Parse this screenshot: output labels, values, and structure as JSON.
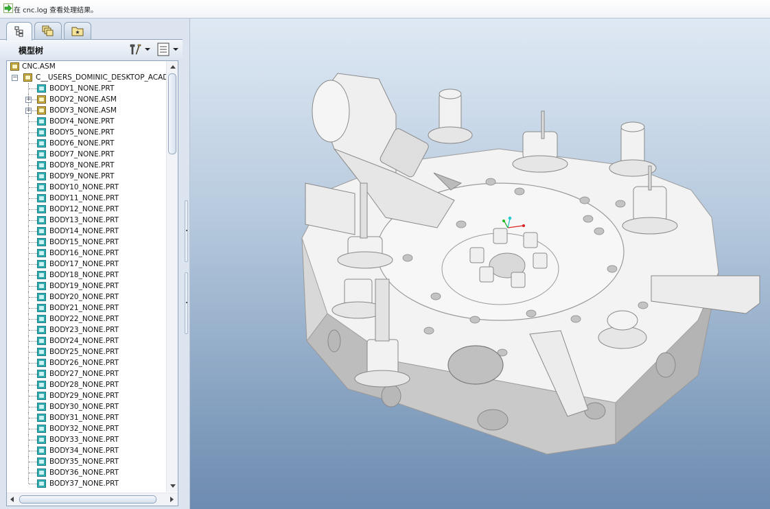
{
  "message": {
    "text": "在 cnc.log 查看处理结果。",
    "icon": "green-arrow-icon"
  },
  "panel": {
    "tabs": [
      {
        "name": "model-tree-tab",
        "icon": "tree-icon",
        "active": true
      },
      {
        "name": "layers-tab",
        "icon": "layers-icon",
        "active": false
      },
      {
        "name": "folder-browser-tab",
        "icon": "folder-icon",
        "active": false
      }
    ],
    "title": "模型树",
    "settings_icon": "tools-icon",
    "show_icon": "list-icon"
  },
  "tree": {
    "root": "CNC.ASM",
    "sub_assembly": "C__USERS_DOMINIC_DESKTOP_ACAD",
    "items": [
      {
        "label": "BODY1_NONE.PRT",
        "type": "part",
        "expandable": false
      },
      {
        "label": "BODY2_NONE.ASM",
        "type": "assembly",
        "expandable": true
      },
      {
        "label": "BODY3_NONE.ASM",
        "type": "assembly",
        "expandable": true
      },
      {
        "label": "BODY4_NONE.PRT",
        "type": "part",
        "expandable": false
      },
      {
        "label": "BODY5_NONE.PRT",
        "type": "part",
        "expandable": false
      },
      {
        "label": "BODY6_NONE.PRT",
        "type": "part",
        "expandable": false
      },
      {
        "label": "BODY7_NONE.PRT",
        "type": "part",
        "expandable": false
      },
      {
        "label": "BODY8_NONE.PRT",
        "type": "part",
        "expandable": false
      },
      {
        "label": "BODY9_NONE.PRT",
        "type": "part",
        "expandable": false
      },
      {
        "label": "BODY10_NONE.PRT",
        "type": "part",
        "expandable": false
      },
      {
        "label": "BODY11_NONE.PRT",
        "type": "part",
        "expandable": false
      },
      {
        "label": "BODY12_NONE.PRT",
        "type": "part",
        "expandable": false
      },
      {
        "label": "BODY13_NONE.PRT",
        "type": "part",
        "expandable": false
      },
      {
        "label": "BODY14_NONE.PRT",
        "type": "part",
        "expandable": false
      },
      {
        "label": "BODY15_NONE.PRT",
        "type": "part",
        "expandable": false
      },
      {
        "label": "BODY16_NONE.PRT",
        "type": "part",
        "expandable": false
      },
      {
        "label": "BODY17_NONE.PRT",
        "type": "part",
        "expandable": false
      },
      {
        "label": "BODY18_NONE.PRT",
        "type": "part",
        "expandable": false
      },
      {
        "label": "BODY19_NONE.PRT",
        "type": "part",
        "expandable": false
      },
      {
        "label": "BODY20_NONE.PRT",
        "type": "part",
        "expandable": false
      },
      {
        "label": "BODY21_NONE.PRT",
        "type": "part",
        "expandable": false
      },
      {
        "label": "BODY22_NONE.PRT",
        "type": "part",
        "expandable": false
      },
      {
        "label": "BODY23_NONE.PRT",
        "type": "part",
        "expandable": false
      },
      {
        "label": "BODY24_NONE.PRT",
        "type": "part",
        "expandable": false
      },
      {
        "label": "BODY25_NONE.PRT",
        "type": "part",
        "expandable": false
      },
      {
        "label": "BODY26_NONE.PRT",
        "type": "part",
        "expandable": false
      },
      {
        "label": "BODY27_NONE.PRT",
        "type": "part",
        "expandable": false
      },
      {
        "label": "BODY28_NONE.PRT",
        "type": "part",
        "expandable": false
      },
      {
        "label": "BODY29_NONE.PRT",
        "type": "part",
        "expandable": false
      },
      {
        "label": "BODY30_NONE.PRT",
        "type": "part",
        "expandable": false
      },
      {
        "label": "BODY31_NONE.PRT",
        "type": "part",
        "expandable": false
      },
      {
        "label": "BODY32_NONE.PRT",
        "type": "part",
        "expandable": false
      },
      {
        "label": "BODY33_NONE.PRT",
        "type": "part",
        "expandable": false
      },
      {
        "label": "BODY34_NONE.PRT",
        "type": "part",
        "expandable": false
      },
      {
        "label": "BODY35_NONE.PRT",
        "type": "part",
        "expandable": false
      },
      {
        "label": "BODY36_NONE.PRT",
        "type": "part",
        "expandable": false
      },
      {
        "label": "BODY37_NONE.PRT",
        "type": "part",
        "expandable": false
      }
    ]
  },
  "colors": {
    "part_icon": "#2fc4c9",
    "assembly_icon": "#e8c23a",
    "viewport_top": "#dfe9f4",
    "viewport_bottom": "#6d8bb0",
    "model_face": "#f1f1f1"
  }
}
